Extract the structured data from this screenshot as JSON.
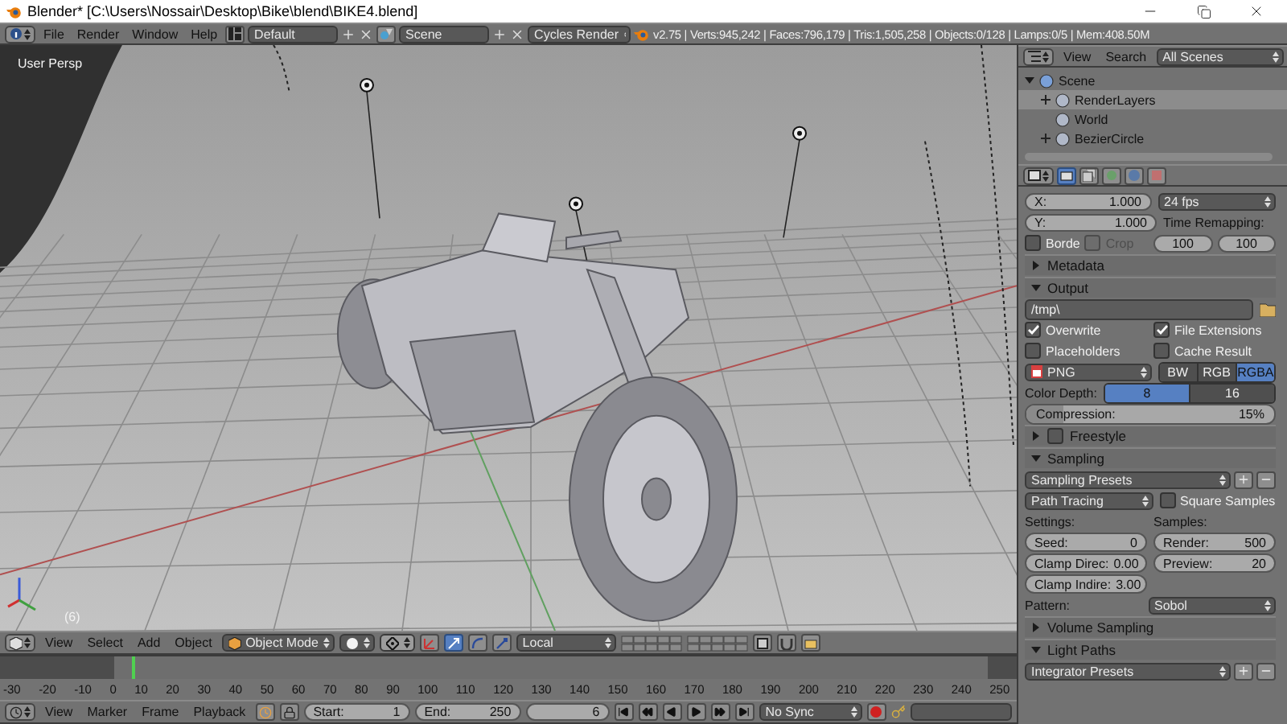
{
  "window": {
    "title": "Blender* [C:\\Users\\Nossair\\Desktop\\Bike\\blend\\BIKE4.blend]"
  },
  "info_header": {
    "menus": [
      "File",
      "Render",
      "Window",
      "Help"
    ],
    "layout": "Default",
    "scene": "Scene",
    "engine": "Cycles Render",
    "stats": "v2.75 | Verts:945,242 | Faces:796,179 | Tris:1,505,258 | Objects:0/128 | Lamps:0/5 | Mem:408.50M"
  },
  "viewport": {
    "view_name": "User Persp",
    "frame": "(6)"
  },
  "viewport_header": {
    "menus": [
      "View",
      "Select",
      "Add",
      "Object"
    ],
    "mode": "Object Mode",
    "orientation": "Local"
  },
  "timeline": {
    "ticks": [
      "-30",
      "-20",
      "-10",
      "0",
      "10",
      "20",
      "30",
      "40",
      "50",
      "60",
      "70",
      "80",
      "90",
      "100",
      "110",
      "120",
      "130",
      "140",
      "150",
      "160",
      "170",
      "180",
      "190",
      "200",
      "210",
      "220",
      "230",
      "240",
      "250"
    ]
  },
  "timeline_header": {
    "menus": [
      "View",
      "Marker",
      "Frame",
      "Playback"
    ],
    "start_label": "Start:",
    "start": "1",
    "end_label": "End:",
    "end": "250",
    "current": "6",
    "sync": "No Sync"
  },
  "outliner": {
    "menus": [
      "View",
      "Search"
    ],
    "filter": "All Scenes",
    "tree": [
      {
        "label": "Scene",
        "expanded": true,
        "selected": false,
        "children": [
          {
            "label": "RenderLayers",
            "expanded": false,
            "selected": true
          },
          {
            "label": "World",
            "selected": false
          },
          {
            "label": "BezierCircle",
            "expanded": false,
            "selected": false
          }
        ]
      }
    ]
  },
  "properties": {
    "tabs": [
      {
        "selected": true
      },
      {
        "selected": false
      },
      {
        "selected": false
      },
      {
        "selected": false
      },
      {
        "selected": false
      }
    ],
    "aspect": [
      {
        "label": "X:",
        "value": "1.000"
      },
      {
        "label": "Y:",
        "value": "1.000"
      }
    ],
    "frame_rate": "24 fps",
    "time_remapping_label": "Time Remapping:",
    "time_remapping": [
      "100",
      "100"
    ],
    "border": {
      "label": "Borde",
      "checked": false
    },
    "crop": {
      "label": "Crop",
      "checked": false,
      "disabled": true
    },
    "metadata": {
      "label": "Metadata",
      "expanded": false
    },
    "output": {
      "label": "Output",
      "expanded": true,
      "path": "/tmp\\",
      "options": [
        {
          "label": "Overwrite",
          "checked": true
        },
        {
          "label": "File Extensions",
          "checked": true
        },
        {
          "label": "Placeholders",
          "checked": false
        },
        {
          "label": "Cache Result",
          "checked": false
        }
      ],
      "format": "PNG",
      "color_modes": [
        {
          "label": "BW",
          "selected": false
        },
        {
          "label": "RGB",
          "selected": false
        },
        {
          "label": "RGBA",
          "selected": true
        }
      ],
      "color_depth_label": "Color Depth:",
      "color_depths": [
        {
          "label": "8",
          "selected": true
        },
        {
          "label": "16",
          "selected": false
        }
      ],
      "compression": {
        "label": "Compression:",
        "reading": "15%",
        "level": 0.15
      }
    },
    "freestyle": {
      "label": "Freestyle",
      "expanded": false,
      "checked": false
    },
    "sampling": {
      "label": "Sampling",
      "expanded": true,
      "presets": "Sampling Presets",
      "integrator": "Path Tracing",
      "square_samples": {
        "label": "Square Samples",
        "checked": false
      },
      "settings_label": "Settings:",
      "samples_label": "Samples:",
      "settings": [
        {
          "label": "Seed:",
          "value": "0"
        },
        {
          "label": "Clamp Direc:",
          "value": "0.00"
        },
        {
          "label": "Clamp Indire:",
          "value": "3.00"
        }
      ],
      "samples": [
        {
          "label": "Render:",
          "value": "500"
        },
        {
          "label": "Preview:",
          "value": "20"
        }
      ],
      "pattern_label": "Pattern:",
      "pattern": "Sobol"
    },
    "volume_sampling": {
      "label": "Volume Sampling",
      "expanded": false
    },
    "light_paths": {
      "label": "Light Paths",
      "expanded": true,
      "presets": "Integrator Presets"
    }
  }
}
